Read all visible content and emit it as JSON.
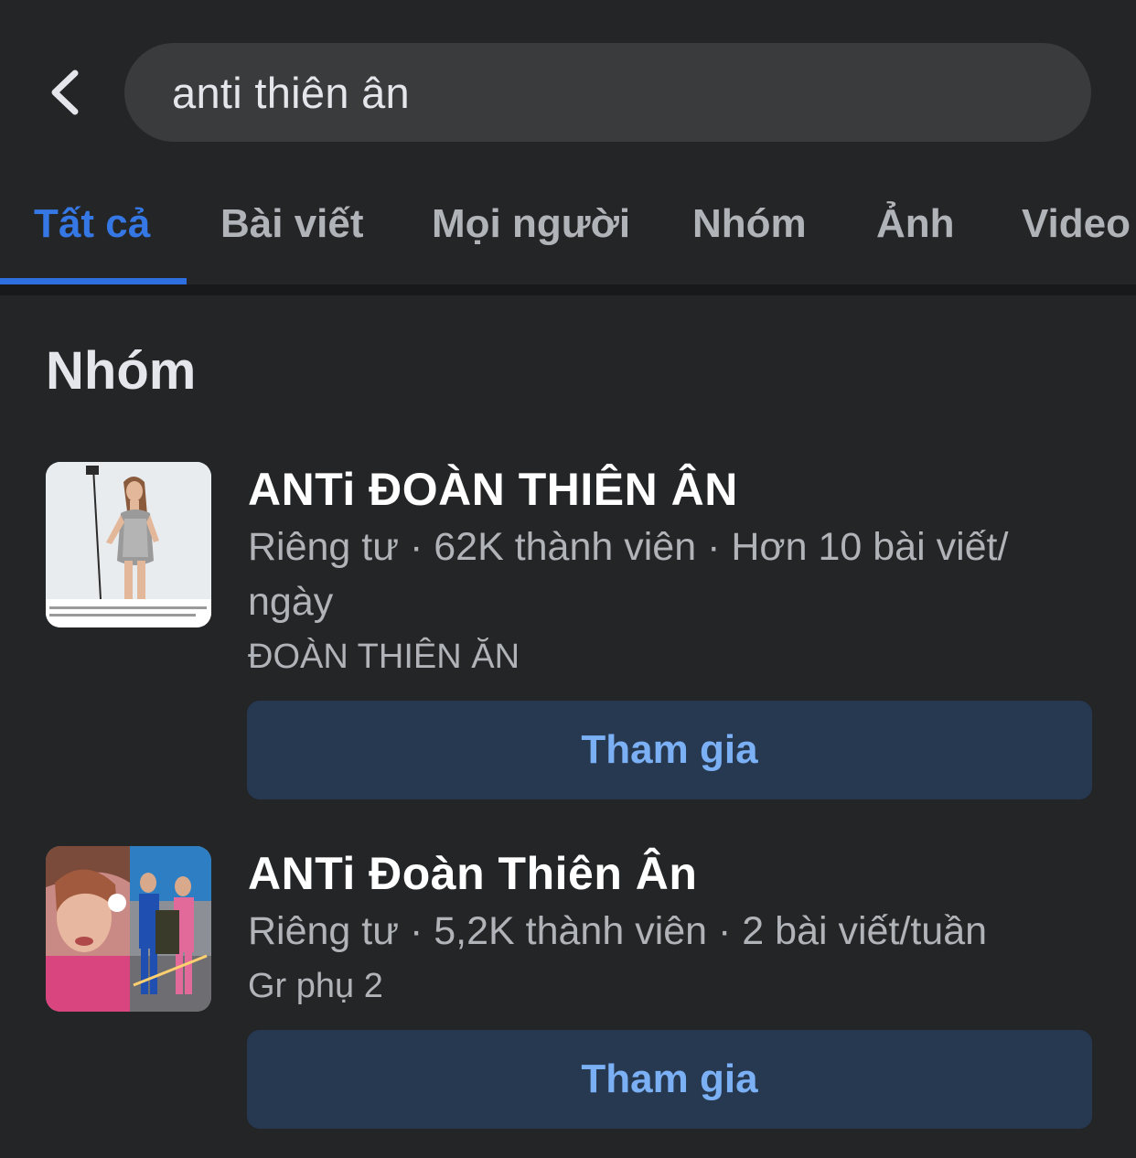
{
  "search": {
    "query": "anti thiên ân"
  },
  "tabs": [
    {
      "label": "Tất cả",
      "active": true
    },
    {
      "label": "Bài viết"
    },
    {
      "label": "Mọi người"
    },
    {
      "label": "Nhóm"
    },
    {
      "label": "Ảnh"
    },
    {
      "label": "Video"
    }
  ],
  "section": {
    "title": "Nhóm"
  },
  "groups": [
    {
      "name": "ANTi ĐOÀN THIÊN ÂN",
      "meta": "Riêng tư · 62K thành viên · Hơn 10 bài viết/ ngày",
      "subtitle": "ĐOÀN THIÊN ĂN",
      "button_label": "Tham gia"
    },
    {
      "name": "ANTi Đoàn Thiên Ân",
      "meta": "Riêng tư · 5,2K thành viên · 2 bài viết/tuần",
      "subtitle": "Gr phụ 2",
      "button_label": "Tham gia"
    }
  ],
  "colors": {
    "background": "#242526",
    "accent": "#3578e5",
    "button_bg": "#263951",
    "button_text": "#7bb0f5"
  }
}
